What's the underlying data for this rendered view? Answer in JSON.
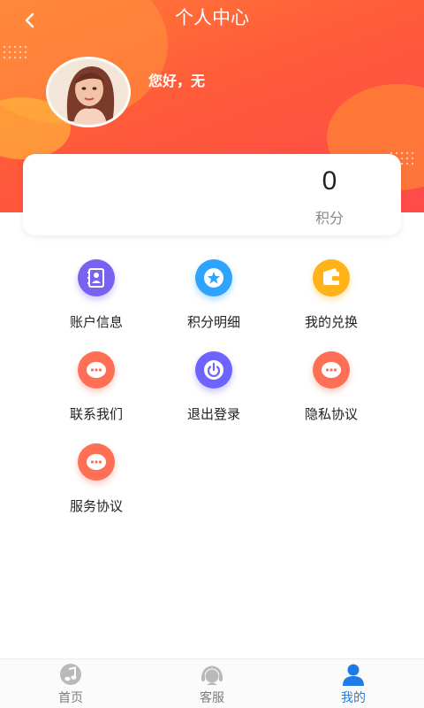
{
  "header": {
    "title": "个人中心",
    "back_icon": "chevron-left-icon",
    "background_colors": [
      "#ff7a38",
      "#ff4a4a"
    ]
  },
  "profile": {
    "greeting": "您好，无",
    "avatar_icon": "avatar-woman-illustration"
  },
  "points": {
    "value": "0",
    "label": "积分"
  },
  "menu": [
    {
      "label": "账户信息",
      "icon": "account-book-icon",
      "color": "#7a62f0"
    },
    {
      "label": "积分明细",
      "icon": "star-badge-icon",
      "color": "#2fa4ff"
    },
    {
      "label": "我的兑换",
      "icon": "wallet-icon",
      "color": "#ffb21a"
    },
    {
      "label": "联系我们",
      "icon": "chat-bubble-icon",
      "color": "#ff6f55"
    },
    {
      "label": "退出登录",
      "icon": "power-icon",
      "color": "#6d63ff"
    },
    {
      "label": "隐私协议",
      "icon": "chat-bubble-icon",
      "color": "#ff6f55"
    },
    {
      "label": "服务协议",
      "icon": "chat-bubble-icon",
      "color": "#ff6f55"
    }
  ],
  "tabbar": {
    "active_color": "#1f7be6",
    "items": [
      {
        "label": "首页",
        "icon": "home-music-icon",
        "active": false
      },
      {
        "label": "客服",
        "icon": "customer-service-headset-icon",
        "active": false
      },
      {
        "label": "我的",
        "icon": "user-icon",
        "active": true
      }
    ]
  }
}
